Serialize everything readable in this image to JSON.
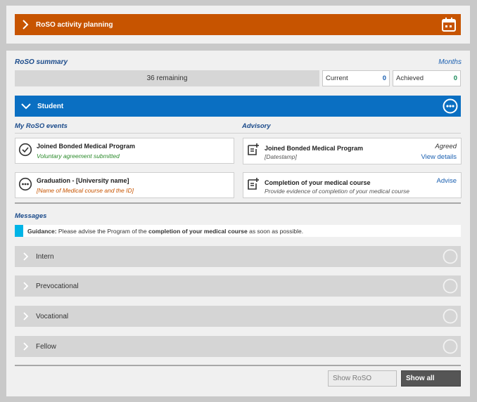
{
  "activity": {
    "title": "RoSO activity planning",
    "icon": "calendar-icon"
  },
  "summary": {
    "title": "RoSO summary",
    "months_link": "Months",
    "remaining": "36 remaining",
    "current": {
      "label": "Current",
      "value": "0"
    },
    "achieved": {
      "label": "Achieved",
      "value": "0"
    }
  },
  "student": {
    "title": "Student"
  },
  "my_events": {
    "heading": "My RoSO events",
    "items": [
      {
        "title": "Joined Bonded Medical Program",
        "subtitle": "Voluntary agreement submitted",
        "icon": "check-circle-icon"
      },
      {
        "title": "Graduation - [University name]",
        "subtitle": "[Name of Medical course and the ID]",
        "icon": "more-circle-icon"
      }
    ]
  },
  "advisory": {
    "heading": "Advisory",
    "items": [
      {
        "title": "Joined Bonded Medical Program",
        "subtitle": "[Datestamp]",
        "status": "Agreed",
        "link": "View details",
        "icon": "note-add-icon"
      },
      {
        "title": "Completion of your medical course",
        "subtitle": "Provide evidence of completion of your medical course",
        "link": "Advise",
        "icon": "note-add-icon"
      }
    ]
  },
  "messages": {
    "heading": "Messages",
    "guidance_label": "Guidance:",
    "guidance_pre": " Please advise the Program of the ",
    "guidance_bold": "completion of your medical course",
    "guidance_post": " as soon as possible."
  },
  "sections": [
    {
      "title": "Intern"
    },
    {
      "title": "Prevocational"
    },
    {
      "title": "Vocational"
    },
    {
      "title": "Fellow"
    }
  ],
  "buttons": {
    "show_roso": "Show RoSO",
    "show_all": "Show all"
  },
  "colors": {
    "activity_bar": "#c75400",
    "student_bar": "#0a6fc2",
    "guidance_tag": "#00b4e6",
    "accordion": "#d5d5d5"
  }
}
